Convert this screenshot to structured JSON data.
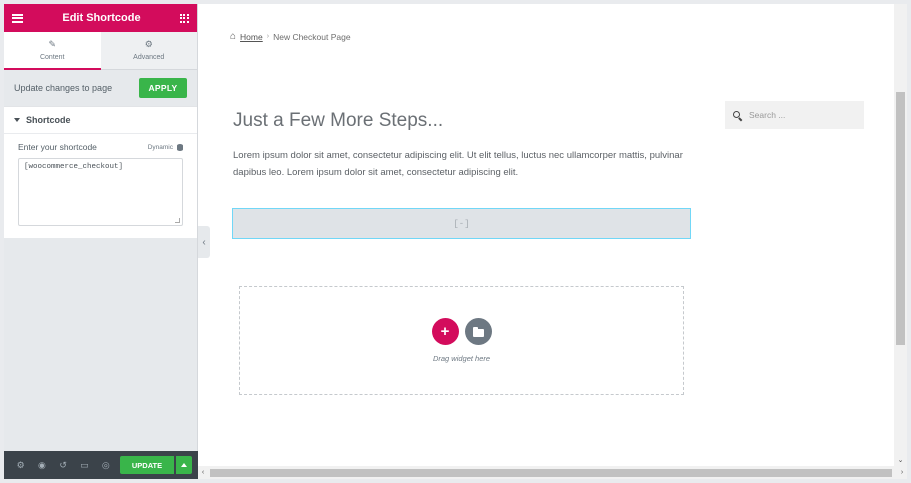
{
  "panel": {
    "title": "Edit Shortcode",
    "tabs": [
      {
        "label": "Content",
        "icon": "pencil-icon"
      },
      {
        "label": "Advanced",
        "icon": "gear-icon"
      }
    ],
    "update_text": "Update changes to page",
    "apply_label": "APPLY",
    "section_title": "Shortcode",
    "control_label": "Enter your shortcode",
    "dynamic_label": "Dynamic",
    "shortcode_value": "[woocommerce_checkout]",
    "footer": {
      "update_label": "UPDATE",
      "icons": [
        "gear-icon",
        "layers-icon",
        "history-icon",
        "responsive-icon",
        "eye-icon"
      ]
    }
  },
  "preview": {
    "breadcrumb": {
      "home": "Home",
      "separator": "›",
      "current": "New Checkout Page"
    },
    "title": "Just a Few More Steps...",
    "body": "Lorem ipsum dolor sit amet, consectetur adipiscing elit. Ut elit tellus, luctus nec ullamcorper mattis, pulvinar dapibus leo. Lorem ipsum dolor sit amet, consectetur adipiscing elit.",
    "search_placeholder": "Search ...",
    "shortcode_placeholder": "[-]",
    "drop_text": "Drag widget here"
  },
  "colors": {
    "brand": "#d30c5c",
    "success": "#39b54a",
    "panel_bg": "#e6e9ec"
  }
}
